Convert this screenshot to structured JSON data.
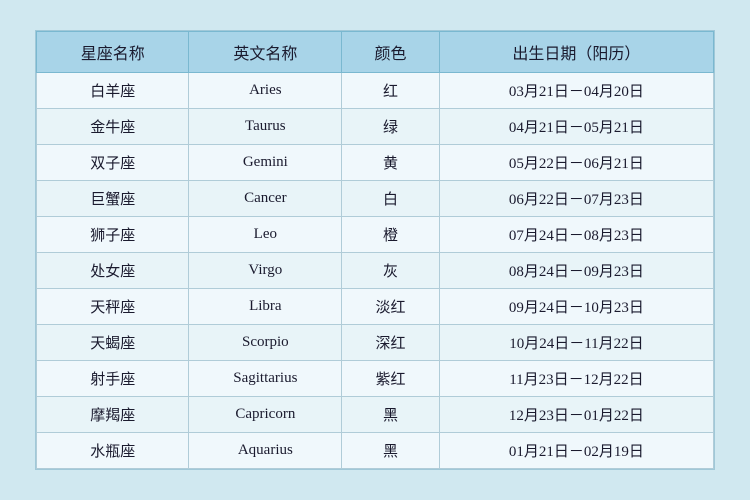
{
  "table": {
    "headers": [
      "星座名称",
      "英文名称",
      "颜色",
      "出生日期（阳历）"
    ],
    "rows": [
      {
        "chinese": "白羊座",
        "english": "Aries",
        "color": "红",
        "dates": "03月21日－04月20日"
      },
      {
        "chinese": "金牛座",
        "english": "Taurus",
        "color": "绿",
        "dates": "04月21日－05月21日"
      },
      {
        "chinese": "双子座",
        "english": "Gemini",
        "color": "黄",
        "dates": "05月22日－06月21日"
      },
      {
        "chinese": "巨蟹座",
        "english": "Cancer",
        "color": "白",
        "dates": "06月22日－07月23日"
      },
      {
        "chinese": "狮子座",
        "english": "Leo",
        "color": "橙",
        "dates": "07月24日－08月23日"
      },
      {
        "chinese": "处女座",
        "english": "Virgo",
        "color": "灰",
        "dates": "08月24日－09月23日"
      },
      {
        "chinese": "天秤座",
        "english": "Libra",
        "color": "淡红",
        "dates": "09月24日－10月23日"
      },
      {
        "chinese": "天蝎座",
        "english": "Scorpio",
        "color": "深红",
        "dates": "10月24日－11月22日"
      },
      {
        "chinese": "射手座",
        "english": "Sagittarius",
        "color": "紫红",
        "dates": "11月23日－12月22日"
      },
      {
        "chinese": "摩羯座",
        "english": "Capricorn",
        "color": "黑",
        "dates": "12月23日－01月22日"
      },
      {
        "chinese": "水瓶座",
        "english": "Aquarius",
        "color": "黑",
        "dates": "01月21日－02月19日"
      }
    ]
  }
}
